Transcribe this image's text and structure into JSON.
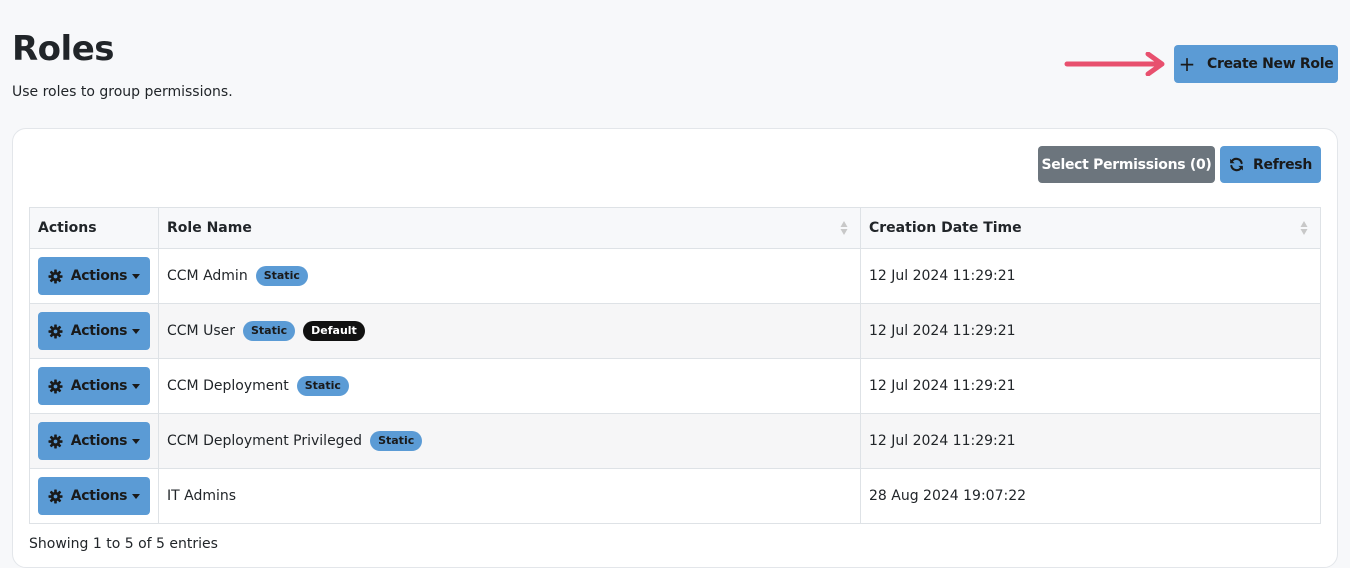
{
  "header": {
    "title": "Roles",
    "subtitle": "Use roles to group permissions.",
    "create_button": "Create New Role"
  },
  "toolbar": {
    "select_permissions": "Select Permissions (0)",
    "refresh": "Refresh"
  },
  "table": {
    "columns": [
      "Actions",
      "Role Name",
      "Creation Date Time"
    ],
    "action_label": "Actions",
    "rows": [
      {
        "name": "CCM Admin",
        "badges": [
          "Static"
        ],
        "created": "12 Jul 2024 11:29:21"
      },
      {
        "name": "CCM User",
        "badges": [
          "Static",
          "Default"
        ],
        "created": "12 Jul 2024 11:29:21"
      },
      {
        "name": "CCM Deployment",
        "badges": [
          "Static"
        ],
        "created": "12 Jul 2024 11:29:21"
      },
      {
        "name": "CCM Deployment Privileged",
        "badges": [
          "Static"
        ],
        "created": "12 Jul 2024 11:29:21"
      },
      {
        "name": "IT Admins",
        "badges": [],
        "created": "28 Aug 2024 19:07:22"
      }
    ]
  },
  "footer": {
    "info": "Showing 1 to 5 of 5 entries"
  },
  "colors": {
    "primary": "#5b9bd5",
    "secondary": "#6c757d",
    "arrow": "#e8506e",
    "badge_default": "#111111"
  },
  "icons": {
    "create": "plus-icon",
    "refresh": "refresh-icon",
    "actions": "gear-icon",
    "dropdown": "caret-down-icon",
    "sort": "sort-icon",
    "callout": "arrow-right-icon"
  }
}
